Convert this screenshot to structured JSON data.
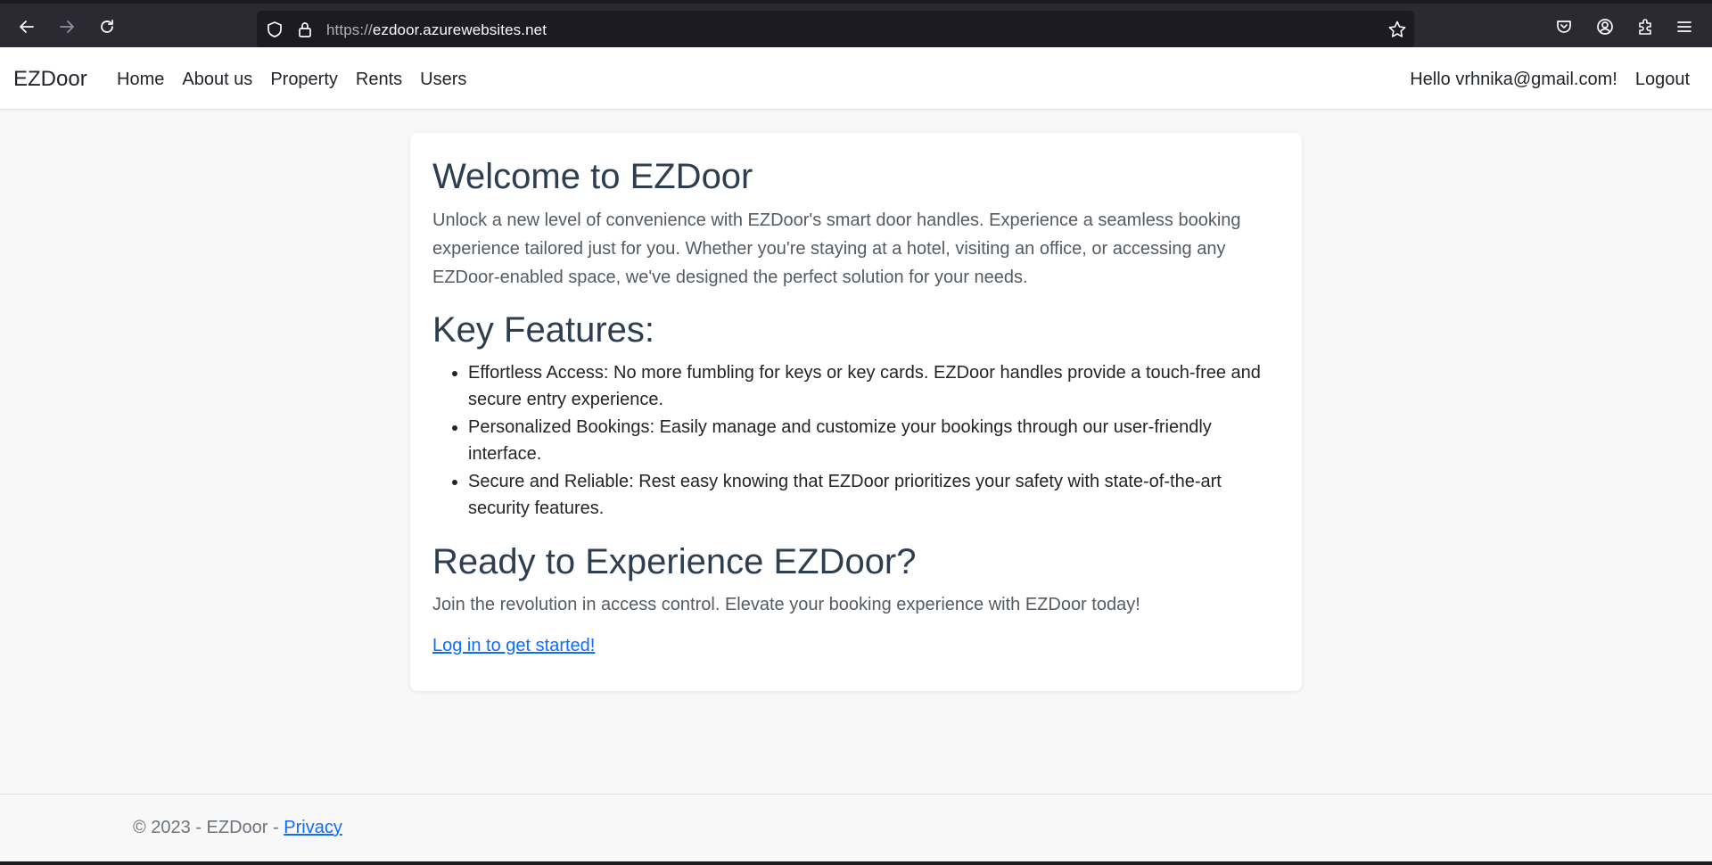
{
  "browser": {
    "url_protocol": "https://",
    "url_host": "ezdoor.azurewebsites.net"
  },
  "navbar": {
    "brand": "EZDoor",
    "links": [
      "Home",
      "About us",
      "Property",
      "Rents",
      "Users"
    ],
    "greeting": "Hello vrhnika@gmail.com!",
    "logout": "Logout"
  },
  "main": {
    "title": "Welcome to EZDoor",
    "intro": "Unlock a new level of convenience with EZDoor's smart door handles. Experience a seamless booking experience tailored just for you. Whether you're staying at a hotel, visiting an office, or accessing any EZDoor-enabled space, we've designed the perfect solution for your needs.",
    "features_title": "Key Features:",
    "features": [
      "Effortless Access: No more fumbling for keys or key cards. EZDoor handles provide a touch-free and secure entry experience.",
      "Personalized Bookings: Easily manage and customize your bookings through our user-friendly interface.",
      "Secure and Reliable: Rest easy knowing that EZDoor prioritizes your safety with state-of-the-art security features."
    ],
    "cta_title": "Ready to Experience EZDoor?",
    "cta_text": "Join the revolution in access control. Elevate your booking experience with EZDoor today!",
    "cta_link": "Log in to get started!"
  },
  "footer": {
    "copyright": "© 2023 - EZDoor - ",
    "privacy": "Privacy"
  },
  "icons": {
    "back": "back-arrow-icon",
    "forward": "forward-arrow-icon",
    "reload": "reload-icon",
    "shield": "shield-icon",
    "lock": "lock-icon",
    "star": "star-icon",
    "pocket": "pocket-icon",
    "account": "account-icon",
    "extensions": "extensions-icon",
    "menu": "hamburger-menu-icon"
  }
}
